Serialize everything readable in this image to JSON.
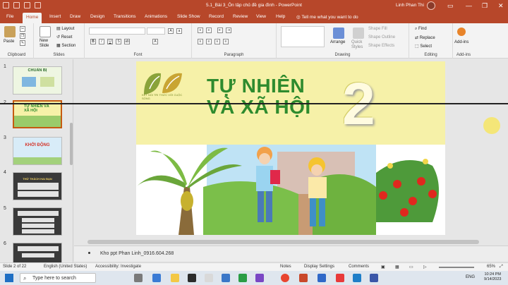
{
  "window": {
    "doc_title": "5.1_Bài 3_Ôn tập chủ đề gia đình  -  PowerPoint",
    "user": "Linh Phan Thi",
    "minimize": "—",
    "restore": "❐",
    "close": "✕"
  },
  "ribbon_tabs": [
    "File",
    "Home",
    "Insert",
    "Draw",
    "Design",
    "Transitions",
    "Animations",
    "Slide Show",
    "Record",
    "Review",
    "View",
    "Help"
  ],
  "tell_me": "Tell me what you want to do",
  "ribbon": {
    "clipboard": {
      "paste": "Paste",
      "label": "Clipboard"
    },
    "slides": {
      "new_slide": "New\nSlide",
      "layout": "Layout",
      "reset": "Reset",
      "section": "Section",
      "label": "Slides"
    },
    "font": {
      "label": "Font"
    },
    "paragraph": {
      "label": "Paragraph"
    },
    "drawing": {
      "arrange": "Arrange",
      "quick_styles": "Quick\nStyles",
      "shape_fill": "Shape Fill",
      "shape_outline": "Shape Outline",
      "shape_effects": "Shape Effects",
      "label": "Drawing"
    },
    "editing": {
      "find": "Find",
      "replace": "Replace",
      "select": "Select",
      "label": "Editing"
    },
    "addins": {
      "addins": "Add-ins",
      "label": "Add-ins"
    }
  },
  "thumbnails": [
    {
      "num": "1",
      "title": "CHUẨN BỊ"
    },
    {
      "num": "2",
      "title": "TỰ NHIÊN VÀ XÃ HỘI"
    },
    {
      "num": "3",
      "title": "KHỞI ĐỘNG"
    },
    {
      "num": "4",
      "title": "THỬ THÁCH HAI BẠN"
    },
    {
      "num": "5",
      "title": ""
    },
    {
      "num": "6",
      "title": ""
    }
  ],
  "slide": {
    "title_line1": "TỰ NHIÊN",
    "title_line2": "VÀ XÃ HỘI",
    "grade": "2",
    "logo_text": "KẾT NỐI TRI THỨC VỚI CUỘC SỐNG"
  },
  "notes_text": "Kho ppt Phan Linh_0916.604.268",
  "status": {
    "slide_of": "Slide 2 of 22",
    "language": "English (United States)",
    "accessibility": "Accessibility: Investigate",
    "notes": "Notes",
    "display": "Display Settings",
    "comments": "Comments",
    "zoom": "65%"
  },
  "taskbar": {
    "search_placeholder": "Type here to search",
    "weather": "ENG",
    "time": "10:24 PM",
    "date": "9/14/2023"
  },
  "colors": {
    "accent": "#b7472a",
    "slide_band": "#f6f1a8",
    "title_green": "#2e8b2e"
  }
}
